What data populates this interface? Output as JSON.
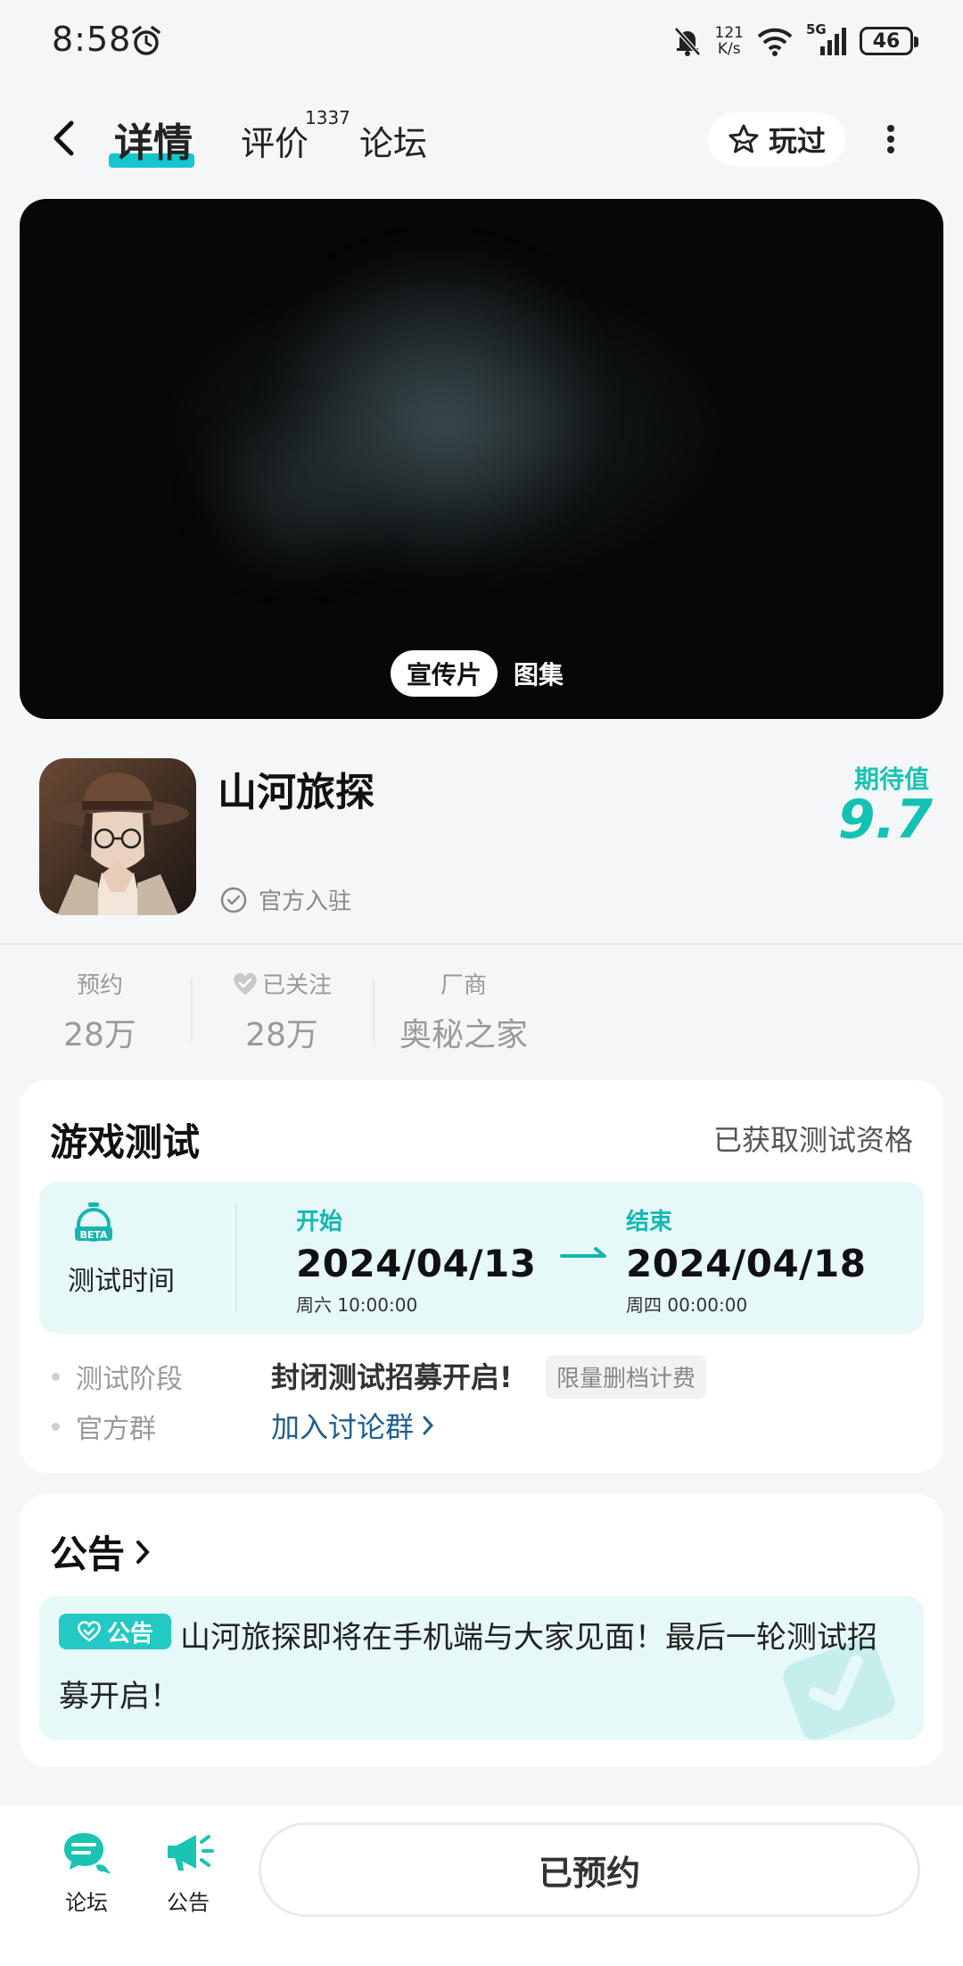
{
  "status_bar": {
    "time": "8:58",
    "net_speed_value": "121",
    "net_speed_unit": "K/s",
    "network": "5G",
    "battery": "46"
  },
  "header": {
    "tabs": [
      {
        "label": "详情",
        "active": true
      },
      {
        "label": "评价",
        "badge": "1337"
      },
      {
        "label": "论坛"
      }
    ],
    "played_label": "玩过"
  },
  "media": {
    "tabs": [
      "宣传片",
      "图集"
    ],
    "active_tab": "宣传片"
  },
  "game": {
    "title": "山河旅探",
    "verified_label": "官方入驻",
    "expect_label": "期待值",
    "expect_value": "9.7"
  },
  "stats": [
    {
      "label": "预约",
      "value": "28万"
    },
    {
      "label": "已关注",
      "value": "28万"
    },
    {
      "label": "厂商",
      "value": "奥秘之家"
    }
  ],
  "test_section": {
    "title": "游戏测试",
    "status": "已获取测试资格",
    "beta_badge": "BETA",
    "time_label": "测试时间",
    "start_label": "开始",
    "start_date": "2024/04/13",
    "start_detail": "周六  10:00:00",
    "end_label": "结束",
    "end_date": "2024/04/18",
    "end_detail": "周四  00:00:00",
    "stage_label": "测试阶段",
    "stage_value": "封闭测试招募开启!",
    "stage_tag": "限量删档计费",
    "group_label": "官方群",
    "group_link": "加入讨论群"
  },
  "notice": {
    "title": "公告",
    "tag": "公告",
    "text": "山河旅探即将在手机端与大家见面！最后一轮测试招募开启！"
  },
  "bottom_bar": {
    "items": [
      {
        "label": "论坛",
        "icon": "forum-icon"
      },
      {
        "label": "公告",
        "icon": "megaphone-icon"
      }
    ],
    "main_button": "已预约"
  },
  "colors": {
    "accent": "#15c5ce",
    "expect": "#13c2b3",
    "link": "#1c5e92",
    "light_panel": "#e6f8f8"
  }
}
